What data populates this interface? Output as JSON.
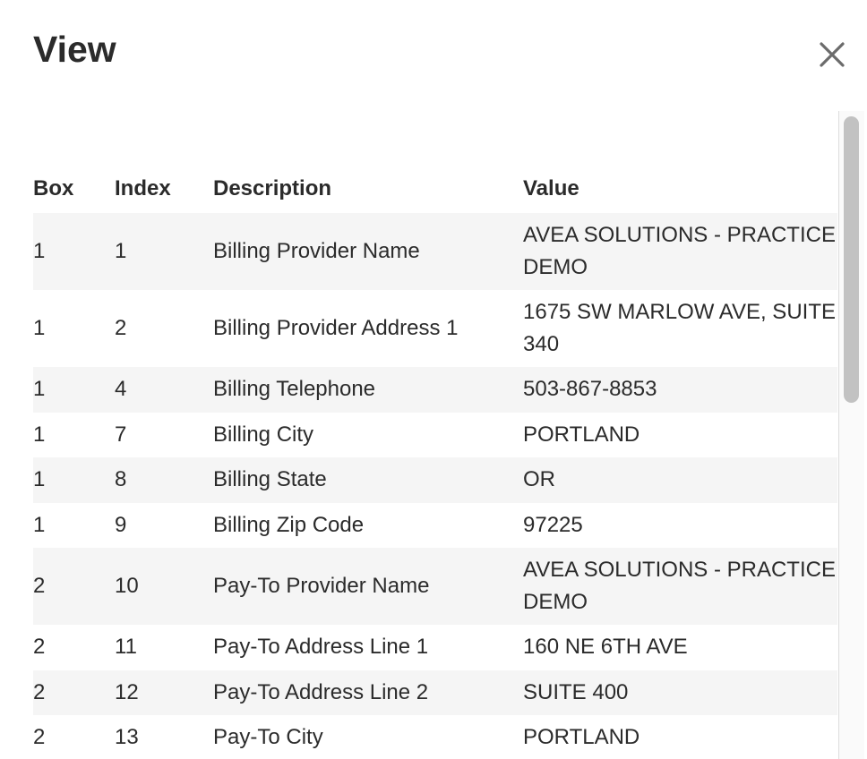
{
  "modal": {
    "title": "View",
    "close_label": "×"
  },
  "table": {
    "columns": [
      "Box",
      "Index",
      "Description",
      "Value"
    ],
    "rows": [
      {
        "box": "1",
        "index": "1",
        "description": "Billing Provider Name",
        "value": "AVEA SOLUTIONS - PRACTICE DEMO"
      },
      {
        "box": "1",
        "index": "2",
        "description": "Billing Provider Address 1",
        "value": "1675 SW MARLOW AVE, SUITE 340"
      },
      {
        "box": "1",
        "index": "4",
        "description": "Billing Telephone",
        "value": "503-867-8853"
      },
      {
        "box": "1",
        "index": "7",
        "description": "Billing City",
        "value": "PORTLAND"
      },
      {
        "box": "1",
        "index": "8",
        "description": "Billing State",
        "value": "OR"
      },
      {
        "box": "1",
        "index": "9",
        "description": "Billing Zip Code",
        "value": "97225"
      },
      {
        "box": "2",
        "index": "10",
        "description": "Pay-To Provider Name",
        "value": "AVEA SOLUTIONS - PRACTICE DEMO"
      },
      {
        "box": "2",
        "index": "11",
        "description": "Pay-To Address Line 1",
        "value": "160 NE 6TH AVE"
      },
      {
        "box": "2",
        "index": "12",
        "description": "Pay-To Address Line 2",
        "value": "SUITE 400"
      },
      {
        "box": "2",
        "index": "13",
        "description": "Pay-To City",
        "value": "PORTLAND"
      }
    ]
  },
  "icons": {
    "close": "close-icon"
  },
  "colors": {
    "row_stripe": "#f5f5f5",
    "text": "#2b2b2b",
    "close_icon": "#6b6b6b",
    "scrollbar_thumb": "#c2c2c2"
  }
}
